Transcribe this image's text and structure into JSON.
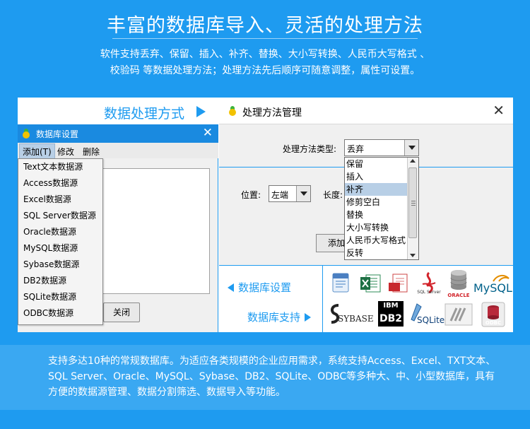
{
  "header": {
    "title": "丰富的数据库导入、灵活的处理方法",
    "subtitle_line1": "软件支持丢弃、保留、插入、补齐、替换、大小写转换、人民币大写格式 、",
    "subtitle_line2": "校验码 等数据处理方法；处理方法先后顺序可随意调整，属性可设置。"
  },
  "left_panel": {
    "heading": "数据处理方式",
    "dialog_title": "数据库设置",
    "menu": {
      "add": "添加(T)",
      "edit": "修改",
      "delete": "删除"
    },
    "datasource_items": [
      "Text文本数据源",
      "Access数据源",
      "Excel数据源",
      "SQL Server数据源",
      "Oracle数据源",
      "MySQL数据源",
      "Sybase数据源",
      "DB2数据源",
      "SQLite数据源",
      "ODBC数据源"
    ],
    "close_button": "关闭"
  },
  "right_panel": {
    "window_title": "处理方法管理",
    "method_type_label": "处理方法类型:",
    "method_type_value": "丢弃",
    "method_options": [
      "保留",
      "插入",
      "补齐",
      "修剪空白",
      "替换",
      "大小写转换",
      "人民币大写格式",
      "反转"
    ],
    "selected_option": "补齐",
    "position_label": "位置:",
    "position_value": "左端",
    "length_label": "长度:",
    "add_button_partial": "添加"
  },
  "db_section": {
    "settings_link": "数据库设置",
    "support_link": "数据库支持",
    "logos": {
      "oracle": "ORACLE",
      "mysql": "MySQL",
      "sqlserver": "SQL Server",
      "sybase": "SYBASE",
      "ibm": "IBM",
      "db2": "DB2",
      "sqlite": "SQLite",
      "odbc": "ODBC"
    }
  },
  "footer": {
    "text": "支持多达10种的常规数据库。为适应各类规模的企业应用需求，系统支持Access、Excel、TXT文本、SQL Server、Oracle、MySQL、Sybase、DB2、SQLite、ODBC等多种大、中、小型数据库，具有方便的数据源管理、数据分割筛选、数据导入等功能。"
  },
  "colors": {
    "background": "#1e9bf0",
    "footer": "#3aa8f2",
    "accent": "#1e9bf0"
  }
}
